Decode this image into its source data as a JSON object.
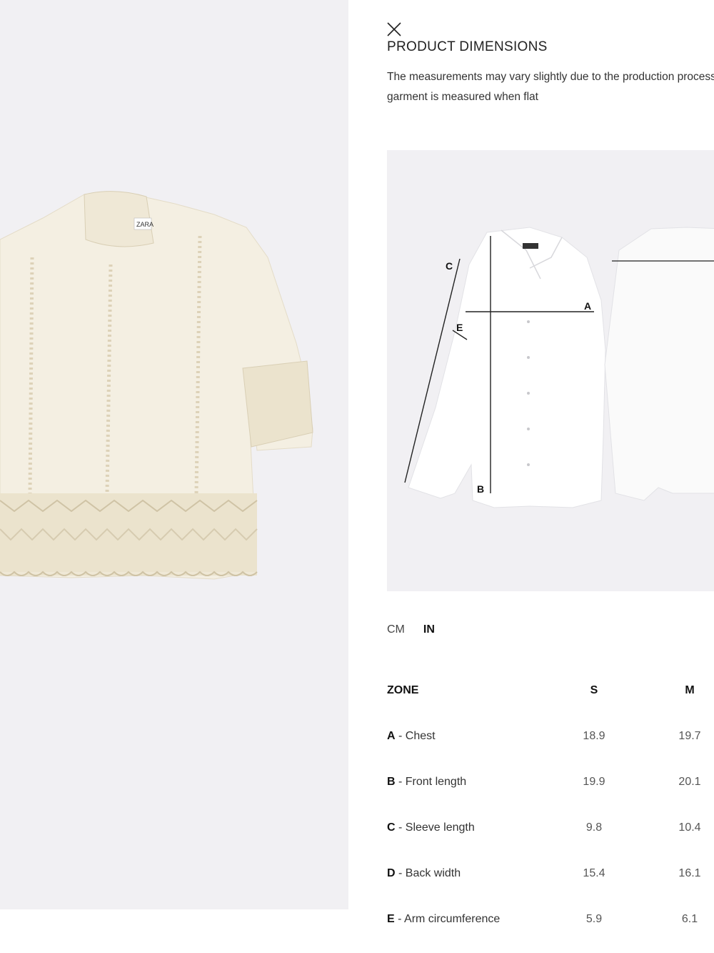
{
  "modal": {
    "title": "PRODUCT DIMENSIONS",
    "description": "The measurements may vary slightly due to the production process. The garment is measured when flat",
    "close_icon": "close-icon"
  },
  "diagram": {
    "labels": {
      "a": "A",
      "b": "B",
      "c": "C",
      "e": "E"
    },
    "brand_tag": "ZARA"
  },
  "units": {
    "cm": "CM",
    "in": "IN",
    "selected": "IN"
  },
  "table": {
    "headers": {
      "zone": "ZONE",
      "s": "S",
      "m": "M"
    },
    "rows": [
      {
        "code": "A",
        "sep": " - ",
        "label": "Chest",
        "s": "18.9",
        "m": "19.7"
      },
      {
        "code": "B",
        "sep": " - ",
        "label": "Front length",
        "s": "19.9",
        "m": "20.1"
      },
      {
        "code": "C",
        "sep": " - ",
        "label": "Sleeve length",
        "s": "9.8",
        "m": "10.4"
      },
      {
        "code": "D",
        "sep": " - ",
        "label": "Back width",
        "s": "15.4",
        "m": "16.1"
      },
      {
        "code": "E",
        "sep": " - ",
        "label": "Arm circumference",
        "s": "5.9",
        "m": "6.1"
      }
    ]
  },
  "colors": {
    "panel_bg": "#f1f0f3",
    "garment": "#f4efe2",
    "lace": "#e6dcc4"
  }
}
